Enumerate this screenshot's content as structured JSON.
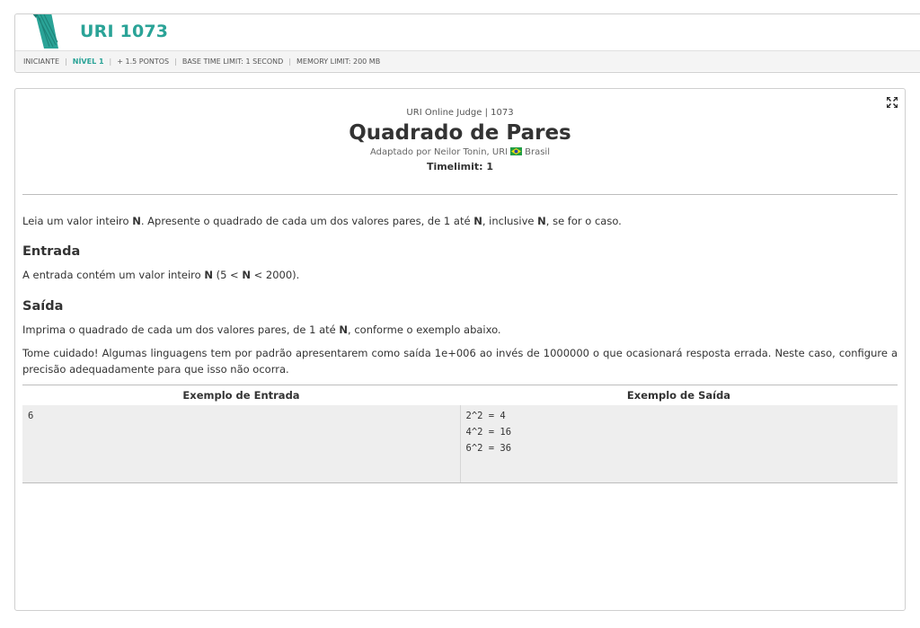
{
  "header": {
    "title": "URI 1073",
    "meta": {
      "category": "INICIANTE",
      "level": "NÍVEL 1",
      "points": "+ 1.5 PONTOS",
      "time_limit": "BASE TIME LIMIT: 1 SECOND",
      "memory_limit": "MEMORY LIMIT: 200 MB"
    }
  },
  "problem": {
    "judge": "URI Online Judge | 1073",
    "title": "Quadrado de Pares",
    "author_prefix": "Adaptado por Neilor Tonin, URI",
    "country": "Brasil",
    "timelimit": "Timelimit: 1",
    "description": {
      "p1": "Leia um valor inteiro ",
      "b1": "N",
      "p2": ". Apresente o quadrado de cada um dos valores pares, de 1 até ",
      "b2": "N",
      "p3": ", inclusive ",
      "b3": "N",
      "p4": ", se for o caso."
    },
    "input_title": "Entrada",
    "input": {
      "p1": "A entrada contém um valor inteiro ",
      "b1": "N",
      "p2": " (5 < ",
      "b2": "N",
      "p3": " < 2000)."
    },
    "output_title": "Saída",
    "output": {
      "p1": "Imprima o quadrado de cada um dos valores pares, de 1 até ",
      "b1": "N",
      "p2": ", conforme o exemplo abaixo."
    },
    "warning": "Tome cuidado! Algumas linguagens tem por padrão apresentarem como saída 1e+006 ao invés de 1000000 o que ocasionará resposta errada. Neste caso, configure a precisão adequadamente para que isso não ocorra.",
    "examples": {
      "input_header": "Exemplo de Entrada",
      "output_header": "Exemplo de Saída",
      "input": "6",
      "output": "2^2 = 4\n4^2 = 16\n6^2 = 36"
    }
  },
  "icons": {
    "logo": "uri-logo-icon",
    "expand": "expand-icon",
    "flag": "brazil-flag-icon"
  },
  "colors": {
    "accent": "#2aa397",
    "example_bg": "#eeeeee"
  }
}
